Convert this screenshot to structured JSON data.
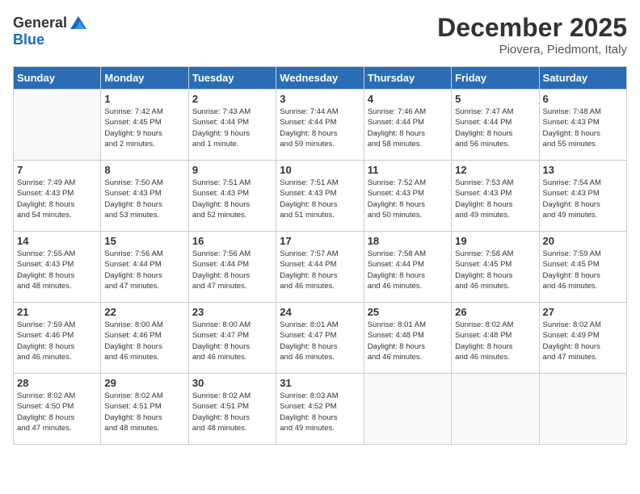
{
  "header": {
    "logo_general": "General",
    "logo_blue": "Blue",
    "month": "December 2025",
    "location": "Piovera, Piedmont, Italy"
  },
  "days_of_week": [
    "Sunday",
    "Monday",
    "Tuesday",
    "Wednesday",
    "Thursday",
    "Friday",
    "Saturday"
  ],
  "weeks": [
    [
      {
        "day": "",
        "info": ""
      },
      {
        "day": "1",
        "info": "Sunrise: 7:42 AM\nSunset: 4:45 PM\nDaylight: 9 hours\nand 2 minutes."
      },
      {
        "day": "2",
        "info": "Sunrise: 7:43 AM\nSunset: 4:44 PM\nDaylight: 9 hours\nand 1 minute."
      },
      {
        "day": "3",
        "info": "Sunrise: 7:44 AM\nSunset: 4:44 PM\nDaylight: 8 hours\nand 59 minutes."
      },
      {
        "day": "4",
        "info": "Sunrise: 7:46 AM\nSunset: 4:44 PM\nDaylight: 8 hours\nand 58 minutes."
      },
      {
        "day": "5",
        "info": "Sunrise: 7:47 AM\nSunset: 4:44 PM\nDaylight: 8 hours\nand 56 minutes."
      },
      {
        "day": "6",
        "info": "Sunrise: 7:48 AM\nSunset: 4:43 PM\nDaylight: 8 hours\nand 55 minutes."
      }
    ],
    [
      {
        "day": "7",
        "info": "Sunrise: 7:49 AM\nSunset: 4:43 PM\nDaylight: 8 hours\nand 54 minutes."
      },
      {
        "day": "8",
        "info": "Sunrise: 7:50 AM\nSunset: 4:43 PM\nDaylight: 8 hours\nand 53 minutes."
      },
      {
        "day": "9",
        "info": "Sunrise: 7:51 AM\nSunset: 4:43 PM\nDaylight: 8 hours\nand 52 minutes."
      },
      {
        "day": "10",
        "info": "Sunrise: 7:51 AM\nSunset: 4:43 PM\nDaylight: 8 hours\nand 51 minutes."
      },
      {
        "day": "11",
        "info": "Sunrise: 7:52 AM\nSunset: 4:43 PM\nDaylight: 8 hours\nand 50 minutes."
      },
      {
        "day": "12",
        "info": "Sunrise: 7:53 AM\nSunset: 4:43 PM\nDaylight: 8 hours\nand 49 minutes."
      },
      {
        "day": "13",
        "info": "Sunrise: 7:54 AM\nSunset: 4:43 PM\nDaylight: 8 hours\nand 49 minutes."
      }
    ],
    [
      {
        "day": "14",
        "info": "Sunrise: 7:55 AM\nSunset: 4:43 PM\nDaylight: 8 hours\nand 48 minutes."
      },
      {
        "day": "15",
        "info": "Sunrise: 7:56 AM\nSunset: 4:44 PM\nDaylight: 8 hours\nand 47 minutes."
      },
      {
        "day": "16",
        "info": "Sunrise: 7:56 AM\nSunset: 4:44 PM\nDaylight: 8 hours\nand 47 minutes."
      },
      {
        "day": "17",
        "info": "Sunrise: 7:57 AM\nSunset: 4:44 PM\nDaylight: 8 hours\nand 46 minutes."
      },
      {
        "day": "18",
        "info": "Sunrise: 7:58 AM\nSunset: 4:44 PM\nDaylight: 8 hours\nand 46 minutes."
      },
      {
        "day": "19",
        "info": "Sunrise: 7:58 AM\nSunset: 4:45 PM\nDaylight: 8 hours\nand 46 minutes."
      },
      {
        "day": "20",
        "info": "Sunrise: 7:59 AM\nSunset: 4:45 PM\nDaylight: 8 hours\nand 46 minutes."
      }
    ],
    [
      {
        "day": "21",
        "info": "Sunrise: 7:59 AM\nSunset: 4:46 PM\nDaylight: 8 hours\nand 46 minutes."
      },
      {
        "day": "22",
        "info": "Sunrise: 8:00 AM\nSunset: 4:46 PM\nDaylight: 8 hours\nand 46 minutes."
      },
      {
        "day": "23",
        "info": "Sunrise: 8:00 AM\nSunset: 4:47 PM\nDaylight: 8 hours\nand 46 minutes."
      },
      {
        "day": "24",
        "info": "Sunrise: 8:01 AM\nSunset: 4:47 PM\nDaylight: 8 hours\nand 46 minutes."
      },
      {
        "day": "25",
        "info": "Sunrise: 8:01 AM\nSunset: 4:48 PM\nDaylight: 8 hours\nand 46 minutes."
      },
      {
        "day": "26",
        "info": "Sunrise: 8:02 AM\nSunset: 4:48 PM\nDaylight: 8 hours\nand 46 minutes."
      },
      {
        "day": "27",
        "info": "Sunrise: 8:02 AM\nSunset: 4:49 PM\nDaylight: 8 hours\nand 47 minutes."
      }
    ],
    [
      {
        "day": "28",
        "info": "Sunrise: 8:02 AM\nSunset: 4:50 PM\nDaylight: 8 hours\nand 47 minutes."
      },
      {
        "day": "29",
        "info": "Sunrise: 8:02 AM\nSunset: 4:51 PM\nDaylight: 8 hours\nand 48 minutes."
      },
      {
        "day": "30",
        "info": "Sunrise: 8:02 AM\nSunset: 4:51 PM\nDaylight: 8 hours\nand 48 minutes."
      },
      {
        "day": "31",
        "info": "Sunrise: 8:03 AM\nSunset: 4:52 PM\nDaylight: 8 hours\nand 49 minutes."
      },
      {
        "day": "",
        "info": ""
      },
      {
        "day": "",
        "info": ""
      },
      {
        "day": "",
        "info": ""
      }
    ]
  ]
}
